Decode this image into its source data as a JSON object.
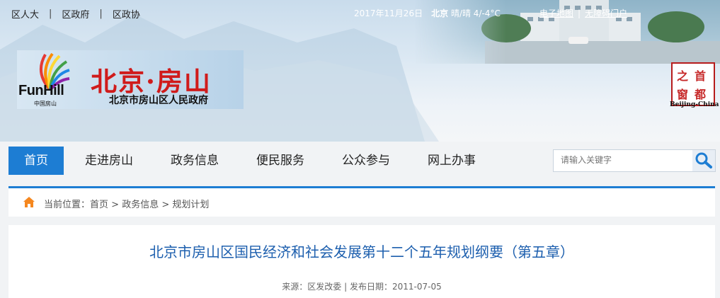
{
  "top_links": [
    "区人大",
    "区政府",
    "区政协"
  ],
  "weather": {
    "date": "2017年11月26日",
    "city": "北京",
    "condition": "晴/晴 4/-4°C"
  },
  "right_links": [
    "电子地图",
    "无障碍门户"
  ],
  "logo": {
    "brand_en": "FunHill",
    "brand_cn_small": "中国房山",
    "title": "北京·房山",
    "subtitle": "北京市房山区人民政府"
  },
  "seal": {
    "chars": [
      "首",
      "都",
      "之",
      "窗"
    ],
    "caption": "Beijing-China"
  },
  "nav": [
    {
      "label": "首页",
      "active": true
    },
    {
      "label": "走进房山"
    },
    {
      "label": "政务信息"
    },
    {
      "label": "便民服务"
    },
    {
      "label": "公众参与"
    },
    {
      "label": "网上办事"
    }
  ],
  "search": {
    "placeholder": "请输入关键字"
  },
  "breadcrumb": {
    "prefix": "当前位置：",
    "items": [
      "首页",
      "政务信息",
      "规划计划"
    ]
  },
  "article": {
    "title": "北京市房山区国民经济和社会发展第十二个五年规划纲要（第五章）",
    "source_label": "来源：",
    "source": "区发改委",
    "date_label": "发布日期：",
    "date": "2011-07-05"
  },
  "colors": {
    "accent": "#1d7dd3",
    "title_blue": "#1d5fae",
    "logo_red": "#d01b1b"
  }
}
